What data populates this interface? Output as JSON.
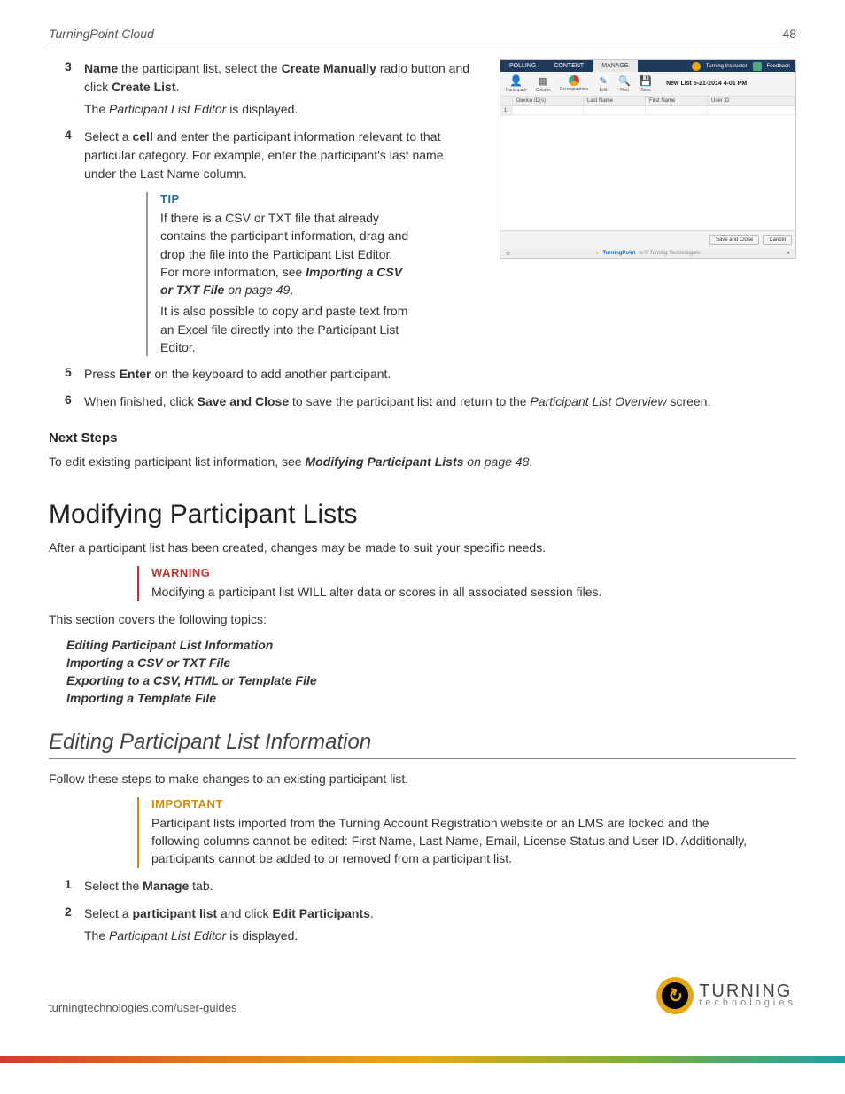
{
  "header": {
    "title": "TurningPoint Cloud",
    "page": "48"
  },
  "steps_a": [
    {
      "num": "3",
      "parts": [
        {
          "t": "bold",
          "v": "Name"
        },
        {
          "t": "plain",
          "v": " the participant list, select the "
        },
        {
          "t": "bold",
          "v": "Create Manually"
        },
        {
          "t": "plain",
          "v": " radio button and click "
        },
        {
          "t": "bold",
          "v": "Create List"
        },
        {
          "t": "plain",
          "v": "."
        }
      ],
      "sub_parts": [
        {
          "t": "plain",
          "v": "The "
        },
        {
          "t": "italic",
          "v": "Participant List Editor"
        },
        {
          "t": "plain",
          "v": " is displayed."
        }
      ]
    },
    {
      "num": "4",
      "parts": [
        {
          "t": "plain",
          "v": "Select a "
        },
        {
          "t": "bold",
          "v": "cell"
        },
        {
          "t": "plain",
          "v": " and enter the participant information relevant to that particular category. For example, enter the participant's last name under the Last Name column."
        }
      ]
    }
  ],
  "tip": {
    "title": "TIP",
    "p1_parts": [
      {
        "t": "plain",
        "v": "If there is a CSV or TXT file that already contains the participant information, drag and drop the file into the Participant List Editor. For more information, see "
      },
      {
        "t": "bolditalic",
        "v": "Importing a CSV or TXT File"
      },
      {
        "t": "italic",
        "v": " on page 49"
      },
      {
        "t": "plain",
        "v": "."
      }
    ],
    "p2": "It is also possible to copy and paste text from an Excel file directly into the Participant List Editor."
  },
  "steps_b": [
    {
      "num": "5",
      "parts": [
        {
          "t": "plain",
          "v": "Press "
        },
        {
          "t": "bold",
          "v": "Enter"
        },
        {
          "t": "plain",
          "v": " on the keyboard to add another participant."
        }
      ]
    },
    {
      "num": "6",
      "parts": [
        {
          "t": "plain",
          "v": "When finished, click "
        },
        {
          "t": "bold",
          "v": "Save and Close"
        },
        {
          "t": "plain",
          "v": " to save the participant list and return to the "
        },
        {
          "t": "italic",
          "v": "Participant List Overview"
        },
        {
          "t": "plain",
          "v": " screen."
        }
      ]
    }
  ],
  "next_steps": {
    "heading": "Next Steps",
    "parts": [
      {
        "t": "plain",
        "v": "To edit existing participant list information, see "
      },
      {
        "t": "bolditalic",
        "v": "Modifying Participant Lists "
      },
      {
        "t": "italic",
        "v": " on page 48"
      },
      {
        "t": "plain",
        "v": "."
      }
    ]
  },
  "section_modify": {
    "h1": "Modifying Participant Lists",
    "intro": "After a participant list has been created, changes may be made to suit your specific needs.",
    "warning": {
      "title": "WARNING",
      "body": "Modifying a participant list WILL alter data or scores in all associated session files."
    },
    "covers": "This section covers the following topics:",
    "topics": [
      "Editing Participant List Information",
      "Importing a CSV or TXT File",
      "Exporting to a CSV, HTML or Template File",
      "Importing a Template File"
    ]
  },
  "section_edit": {
    "h2": "Editing Participant List Information",
    "intro": "Follow these steps to make changes to an existing participant list.",
    "important": {
      "title": "IMPORTANT",
      "body": "Participant lists imported from the Turning Account Registration website or an LMS are locked and the following columns cannot be edited: First Name, Last Name, Email, License Status and User ID. Additionally, participants cannot be added to or removed from a participant list."
    },
    "steps": [
      {
        "num": "1",
        "parts": [
          {
            "t": "plain",
            "v": "Select the "
          },
          {
            "t": "bold",
            "v": "Manage"
          },
          {
            "t": "plain",
            "v": " tab."
          }
        ]
      },
      {
        "num": "2",
        "parts": [
          {
            "t": "plain",
            "v": "Select a "
          },
          {
            "t": "bold",
            "v": "participant list"
          },
          {
            "t": "plain",
            "v": " and click "
          },
          {
            "t": "bold",
            "v": "Edit Participants"
          },
          {
            "t": "plain",
            "v": "."
          }
        ],
        "sub_parts": [
          {
            "t": "plain",
            "v": "The "
          },
          {
            "t": "italic",
            "v": "Participant List Editor"
          },
          {
            "t": "plain",
            "v": " is displayed."
          }
        ]
      }
    ]
  },
  "screenshot": {
    "tabs": [
      "POLLING",
      "CONTENT",
      "MANAGE"
    ],
    "active_tab": 2,
    "account": "Turning Instructor",
    "feedback": "Feedback",
    "toolbar": [
      {
        "label": "Participant",
        "icon": "person"
      },
      {
        "label": "Column",
        "icon": "grid"
      },
      {
        "label": "Demographics",
        "icon": "pie"
      },
      {
        "label": "Edit",
        "icon": "pencil"
      },
      {
        "label": "Find",
        "icon": "search"
      },
      {
        "label": "Save",
        "icon": "save"
      }
    ],
    "list_title": "New List 5-21-2014 4-01 PM",
    "columns": [
      "",
      "Device ID(s)",
      "Last Name",
      "First Name",
      "User ID"
    ],
    "row_num": "1",
    "buttons": [
      "Save and Close",
      "Cancel"
    ],
    "status_brand": "TurningPoint",
    "status_sub": "is © Turning Technologies"
  },
  "footer": {
    "url": "turningtechnologies.com/user-guides",
    "logo_top": "TURNING",
    "logo_bottom": "technologies"
  }
}
